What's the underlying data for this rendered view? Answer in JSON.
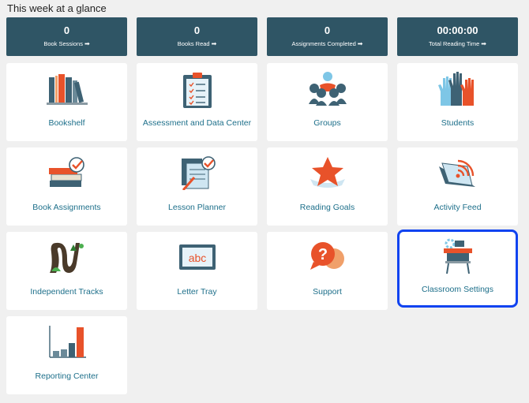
{
  "heading": "This week at a glance",
  "stats": [
    {
      "value": "0",
      "label": "Book Sessions"
    },
    {
      "value": "0",
      "label": "Books Read"
    },
    {
      "value": "0",
      "label": "Assignments Completed"
    },
    {
      "value": "00:00:00",
      "label": "Total Reading Time"
    }
  ],
  "tiles": [
    {
      "label": "Bookshelf",
      "icon": "bookshelf-icon"
    },
    {
      "label": "Assessment and Data Center",
      "icon": "clipboard-icon"
    },
    {
      "label": "Groups",
      "icon": "group-icon"
    },
    {
      "label": "Students",
      "icon": "raised-hands-icon"
    },
    {
      "label": "Book Assignments",
      "icon": "book-stack-check-icon"
    },
    {
      "label": "Lesson Planner",
      "icon": "lesson-plan-icon"
    },
    {
      "label": "Reading Goals",
      "icon": "star-icon"
    },
    {
      "label": "Activity Feed",
      "icon": "open-book-feed-icon"
    },
    {
      "label": "Independent Tracks",
      "icon": "winding-path-icon"
    },
    {
      "label": "Letter Tray",
      "icon": "abc-board-icon"
    },
    {
      "label": "Support",
      "icon": "question-bubble-icon"
    },
    {
      "label": "Classroom Settings",
      "icon": "desk-gear-icon"
    },
    {
      "label": "Reporting Center",
      "icon": "bar-chart-icon"
    }
  ],
  "selected_tile": "Classroom Settings",
  "colors": {
    "stat_bg": "#2f5565",
    "label": "#1d6f8a",
    "selected_border": "#1043f0",
    "accent": "#e8522a"
  }
}
